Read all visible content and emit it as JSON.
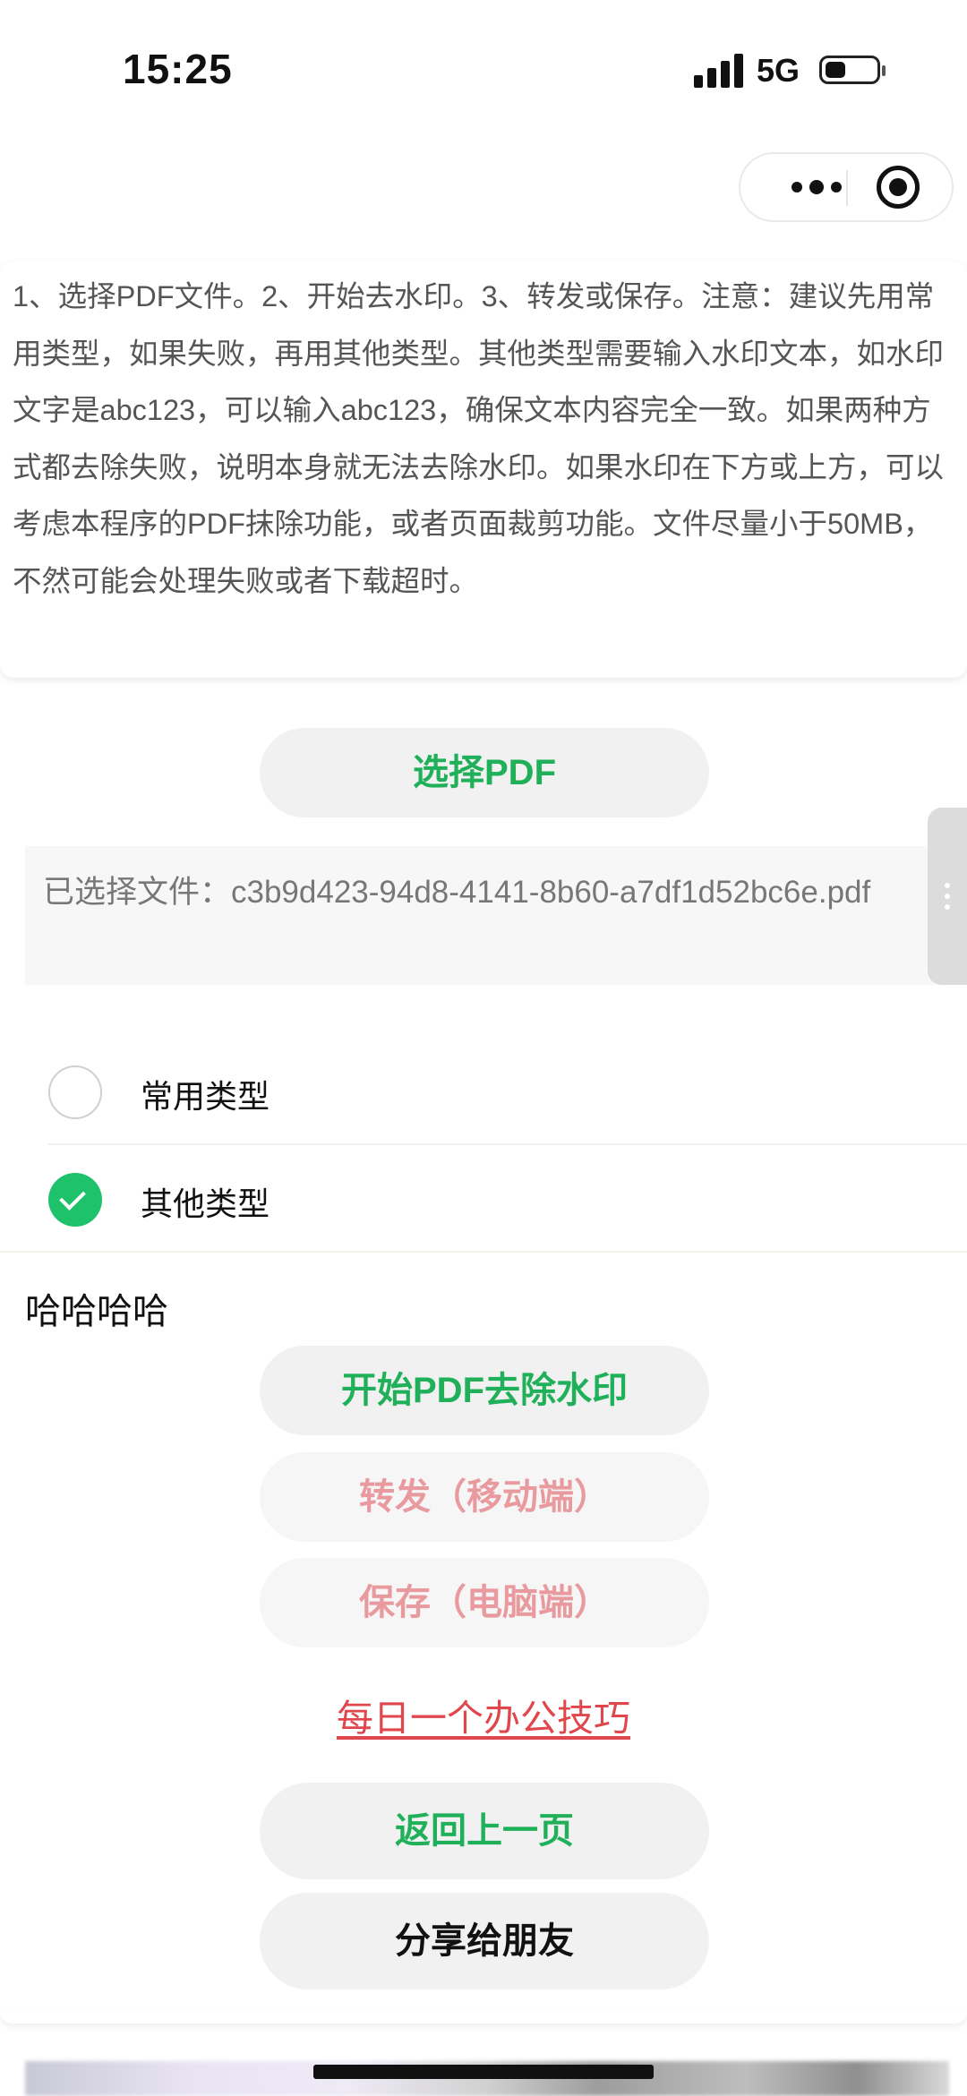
{
  "status_bar": {
    "time": "15:25",
    "network": "5G"
  },
  "instructions": {
    "text": "1、选择PDF文件。2、开始去水印。3、转发或保存。注意：建议先用常用类型，如果失败，再用其他类型。其他类型需要输入水印文本，如水印文字是abc123，可以输入abc123，确保文本内容完全一致。如果两种方式都去除失败，说明本身就无法去除水印。如果水印在下方或上方，可以考虑本程序的PDF抹除功能，或者页面裁剪功能。文件尽量小于50MB，不然可能会处理失败或者下载超时。"
  },
  "select_button": {
    "label": "选择PDF"
  },
  "file": {
    "text": "已选择文件：c3b9d423-94d8-4141-8b60-a7df1d52bc6e.pdf"
  },
  "types": {
    "options": [
      {
        "label": "常用类型",
        "selected": false
      },
      {
        "label": "其他类型",
        "selected": true
      }
    ]
  },
  "watermark_text": "哈哈哈哈",
  "actions": {
    "start": "开始PDF去除水印",
    "forward": "转发（移动端）",
    "save": "保存（电脑端）",
    "tip": "每日一个办公技巧",
    "back": "返回上一页",
    "share": "分享给朋友"
  },
  "colors": {
    "primary_green": "#20b05a",
    "disabled_pink": "#e99a9f",
    "link_red": "#e0474c",
    "radio_checked": "#1ec26a"
  },
  "icons": [
    "signal-icon",
    "battery-icon",
    "more-icon",
    "target-icon",
    "side-handle-icon",
    "checkmark-icon"
  ]
}
